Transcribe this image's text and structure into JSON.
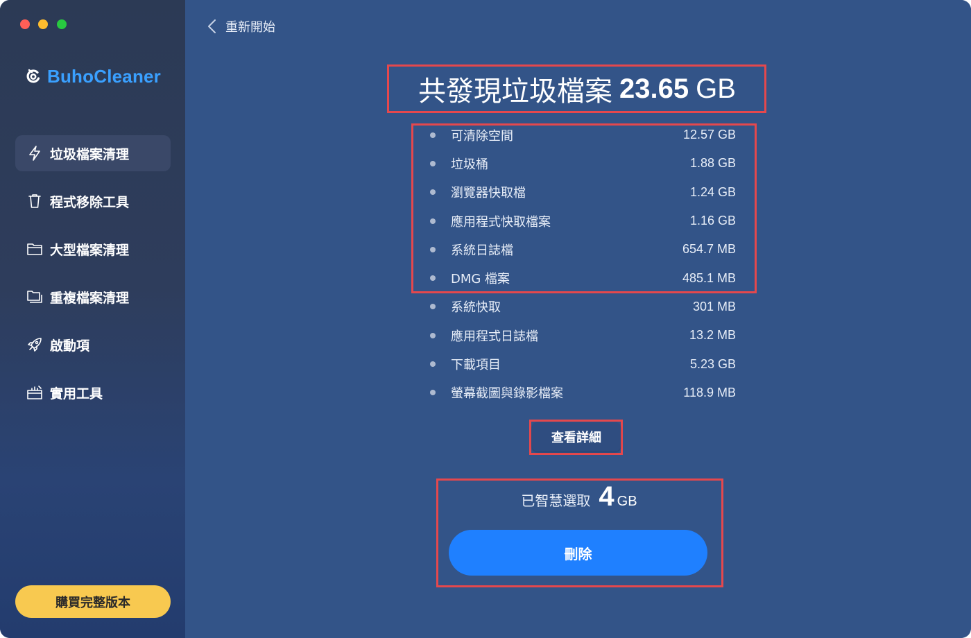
{
  "window": {
    "traffic_lights": [
      "close",
      "minimize",
      "zoom"
    ]
  },
  "sidebar": {
    "brand": "BuhoCleaner",
    "items": [
      {
        "label": "垃圾檔案清理",
        "icon": "lightning-icon",
        "active": true
      },
      {
        "label": "程式移除工具",
        "icon": "trash-icon",
        "active": false
      },
      {
        "label": "大型檔案清理",
        "icon": "folder-icon",
        "active": false
      },
      {
        "label": "重複檔案清理",
        "icon": "duplicate-folder-icon",
        "active": false
      },
      {
        "label": "啟動項",
        "icon": "rocket-icon",
        "active": false
      },
      {
        "label": "實用工具",
        "icon": "toolbox-icon",
        "active": false
      }
    ],
    "buy_label": "購買完整版本"
  },
  "main": {
    "back_label": "重新開始",
    "title_prefix": "共發現垃圾檔案",
    "title_value": "23.65",
    "title_unit": "GB",
    "items": [
      {
        "label": "可清除空間",
        "value": "12.57 GB"
      },
      {
        "label": "垃圾桶",
        "value": "1.88 GB"
      },
      {
        "label": "瀏覽器快取檔",
        "value": "1.24 GB"
      },
      {
        "label": "應用程式快取檔案",
        "value": "1.16 GB"
      },
      {
        "label": "系統日誌檔",
        "value": "654.7 MB"
      },
      {
        "label": "DMG 檔案",
        "value": "485.1 MB"
      },
      {
        "label": "系統快取",
        "value": "301 MB"
      },
      {
        "label": "應用程式日誌檔",
        "value": "13.2 MB"
      },
      {
        "label": "下載項目",
        "value": "5.23 GB"
      },
      {
        "label": "螢幕截圖與錄影檔案",
        "value": "118.9 MB"
      }
    ],
    "details_label": "查看詳細",
    "selected_label": "已智慧選取",
    "selected_value": "4",
    "selected_unit": "GB",
    "delete_label": "刪除"
  },
  "colors": {
    "main_bg": "#335488",
    "brand": "#3aa0ff",
    "buy_button": "#f8c950",
    "delete_button": "#1f80ff",
    "highlight_box": "#e5484d"
  }
}
